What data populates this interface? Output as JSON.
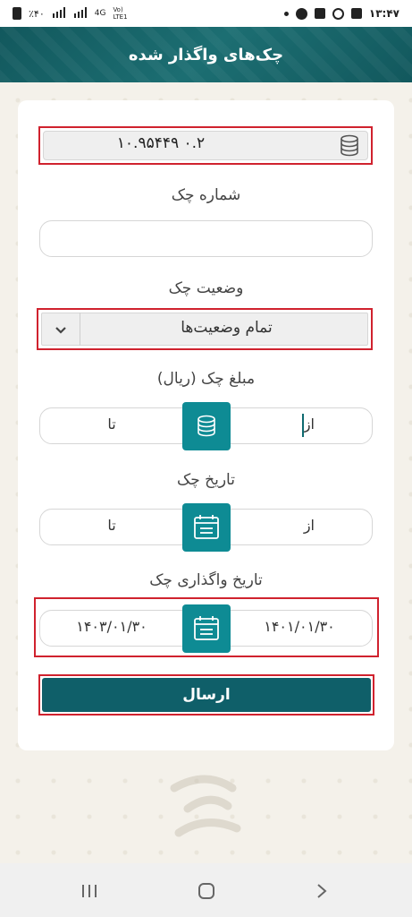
{
  "status_bar": {
    "battery": "٪۴۰",
    "network_left": "4G",
    "network_right": "Vo) LTE1",
    "time": "۱۳:۴۷"
  },
  "header": {
    "title": "چک‌های واگذار شده"
  },
  "balance": {
    "value": "۱۰.۹۵۴۴۹ ۰.۲",
    "icon": "coins-stack-icon"
  },
  "check_number": {
    "label": "شماره چک",
    "value": ""
  },
  "check_status": {
    "label": "وضعیت چک",
    "selected": "تمام وضعیت‌ها"
  },
  "check_amount": {
    "label": "مبلغ چک (ریال)",
    "from": "از",
    "to": "تا"
  },
  "check_date": {
    "label": "تاریخ چک",
    "from": "از",
    "to": "تا"
  },
  "assignment_date": {
    "label": "تاریخ واگذاری چک",
    "from": "۱۴۰۱/۰۱/۳۰",
    "to": "۱۴۰۳/۰۱/۳۰"
  },
  "submit": {
    "label": "ارسال"
  },
  "colors": {
    "primary": "#0f5f69",
    "accent": "#0e8b94",
    "highlight": "#d0222e"
  }
}
